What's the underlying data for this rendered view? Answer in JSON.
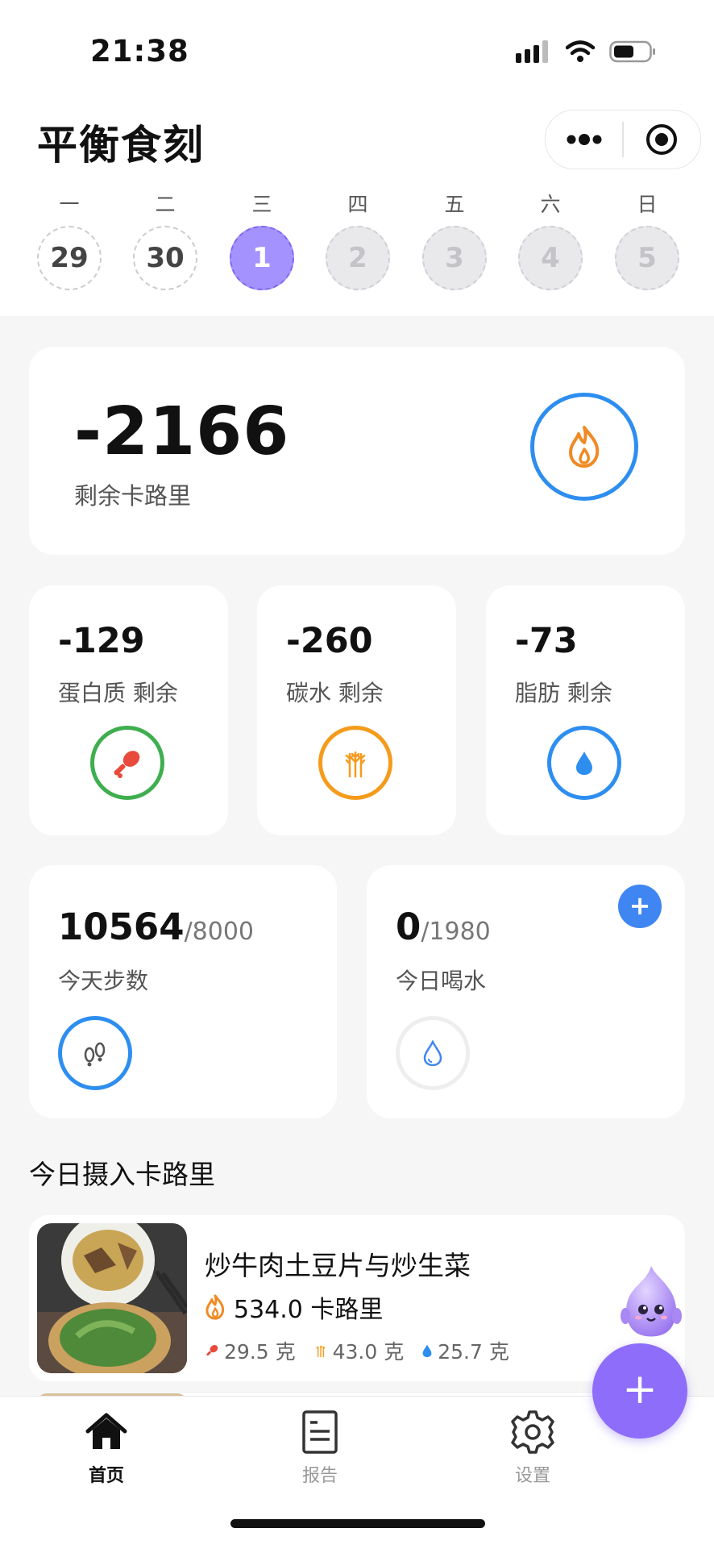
{
  "status_bar": {
    "time": "21:38"
  },
  "app": {
    "title": "平衡食刻"
  },
  "week": [
    {
      "weekday": "一",
      "date": "29",
      "state": "past"
    },
    {
      "weekday": "二",
      "date": "30",
      "state": "past"
    },
    {
      "weekday": "三",
      "date": "1",
      "state": "active"
    },
    {
      "weekday": "四",
      "date": "2",
      "state": "future"
    },
    {
      "weekday": "五",
      "date": "3",
      "state": "future"
    },
    {
      "weekday": "六",
      "date": "4",
      "state": "future"
    },
    {
      "weekday": "日",
      "date": "5",
      "state": "future"
    }
  ],
  "calories": {
    "remaining": "-2166",
    "label": "剩余卡路里",
    "icon": "flame-icon",
    "ring_color": "#2e8ef0",
    "icon_color": "#f08a24"
  },
  "macros": [
    {
      "value": "-129",
      "label": "蛋白质 剩余",
      "icon": "drumstick-icon",
      "ring_color": "#3fae4f",
      "icon_color": "#e84a3c"
    },
    {
      "value": "-260",
      "label": "碳水 剩余",
      "icon": "wheat-icon",
      "ring_color": "#f59b1c",
      "icon_color": "#f59b1c"
    },
    {
      "value": "-73",
      "label": "脂肪 剩余",
      "icon": "drop-icon",
      "ring_color": "#2e8ef0",
      "icon_color": "#2e8ef0"
    }
  ],
  "steps": {
    "value": "10564",
    "goal": "/8000",
    "label": "今天步数",
    "icon": "footprints-icon",
    "ring_color": "#2e8ef0"
  },
  "water": {
    "value": "0",
    "goal": "/1980",
    "label": "今日喝水",
    "icon": "water-drop-icon",
    "add_label": "+"
  },
  "intake": {
    "title": "今日摄入卡路里",
    "meals": [
      {
        "name": "炒牛肉土豆片与炒生菜",
        "calories": "534.0 卡路里",
        "protein": "29.5 克",
        "carbs": "43.0 克",
        "fat": "25.7 克"
      }
    ]
  },
  "fab": {
    "label": "+"
  },
  "tabs": [
    {
      "label": "首页",
      "icon": "home-icon",
      "active": true
    },
    {
      "label": "报告",
      "icon": "report-icon",
      "active": false
    },
    {
      "label": "设置",
      "icon": "gear-icon",
      "active": false
    }
  ]
}
